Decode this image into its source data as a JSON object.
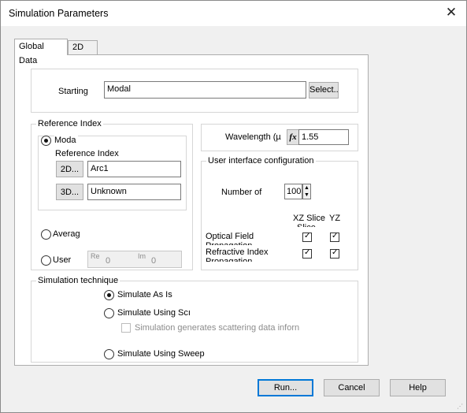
{
  "window": {
    "title": "Simulation Parameters",
    "close_glyph": "✕"
  },
  "tabs": [
    {
      "label": "Global Data"
    },
    {
      "label": "2D"
    }
  ],
  "starting": {
    "label": "Starting",
    "value": "Modal",
    "select_label": "Select.."
  },
  "reference_index": {
    "group_label": "Reference Index",
    "modal": {
      "label": "Moda"
    },
    "sub_label": "Reference Index",
    "row2d": {
      "button": "2D...",
      "value": "Arc1"
    },
    "row3d": {
      "button": "3D...",
      "value": "Unknown"
    },
    "average": {
      "label": "Averag"
    },
    "user": {
      "label": "User",
      "re_label": "Re",
      "re_value": "0",
      "im_label": "Im",
      "im_value": "0"
    }
  },
  "wavelength": {
    "label": "Wavelength (µ",
    "fx_label": "fx",
    "value": "1.55"
  },
  "ui_config": {
    "group_label": "User interface configuration",
    "number_label": "Number of",
    "number_value": "100",
    "col_xz": "XZ Slice",
    "col_xz_sub": "Slice",
    "col_yz": "YZ",
    "rows": [
      {
        "label": "Optical Field",
        "label2": "Propagation",
        "xz": true,
        "yz": true
      },
      {
        "label": "Refractive Index",
        "label2": "Propagation",
        "xz": true,
        "yz": true
      }
    ]
  },
  "technique": {
    "group_label": "Simulation technique",
    "as_is": "Simulate As Is",
    "using_sc": "Simulate Using Scı",
    "scatter_check": "Simulation generates scattering data inforn",
    "using_sweep": "Simulate Using Sweep",
    "selected": "as_is"
  },
  "buttons": {
    "run": "Run...",
    "cancel": "Cancel",
    "help": "Help"
  }
}
